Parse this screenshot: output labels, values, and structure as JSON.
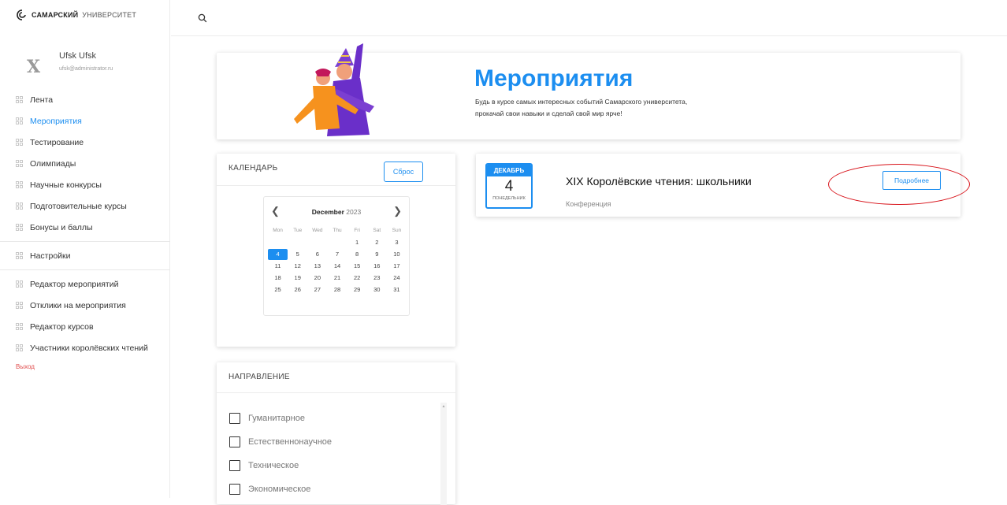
{
  "logo": {
    "bold": "САМАРСКИЙ",
    "thin": "УНИВЕРСИТЕТ"
  },
  "user": {
    "avatar_letter": "X",
    "name": "Ufsk Ufsk",
    "email": "ufsk@administrator.ru"
  },
  "sidebar": {
    "items_main": [
      {
        "label": "Лента",
        "active": false
      },
      {
        "label": "Мероприятия",
        "active": true
      },
      {
        "label": "Тестирование",
        "active": false
      },
      {
        "label": "Олимпиады",
        "active": false
      },
      {
        "label": "Научные конкурсы",
        "active": false
      },
      {
        "label": "Подготовительные курсы",
        "active": false
      },
      {
        "label": "Бонусы и баллы",
        "active": false
      }
    ],
    "settings_label": "Настройки",
    "items_admin": [
      {
        "label": "Редактор мероприятий"
      },
      {
        "label": "Отклики на мероприятия"
      },
      {
        "label": "Редактор курсов"
      },
      {
        "label": "Участники королёвских чтений"
      }
    ],
    "logout_label": "Выход"
  },
  "hero": {
    "title": "Мероприятия",
    "text": "Будь в курсе самых интересных событий Самарского университета, прокачай свои навыки и сделай свой мир ярче!"
  },
  "calendar_card": {
    "title": "КАЛЕНДАРЬ",
    "reset_label": "Сброс",
    "month": "December",
    "year": "2023",
    "weekdays": [
      "Mon",
      "Tue",
      "Wed",
      "Thu",
      "Fri",
      "Sat",
      "Sun"
    ],
    "leading_blanks": 4,
    "days_in_month": 31,
    "selected_day": 4
  },
  "direction_card": {
    "title": "НАПРАВЛЕНИЕ",
    "options": [
      "Гуманитарное",
      "Естественнонаучное",
      "Техническое",
      "Экономическое"
    ]
  },
  "event": {
    "month": "ДЕКАБРЬ",
    "day": "4",
    "weekday": "ПОНЕДЕЛЬНИК",
    "title": "XIX Королёвские чтения: школьники",
    "type": "Конференция",
    "more_label": "Подробнее"
  },
  "colors": {
    "accent": "#1c8ef0",
    "highlight": "#d8131a",
    "logout": "#e04c4c"
  }
}
